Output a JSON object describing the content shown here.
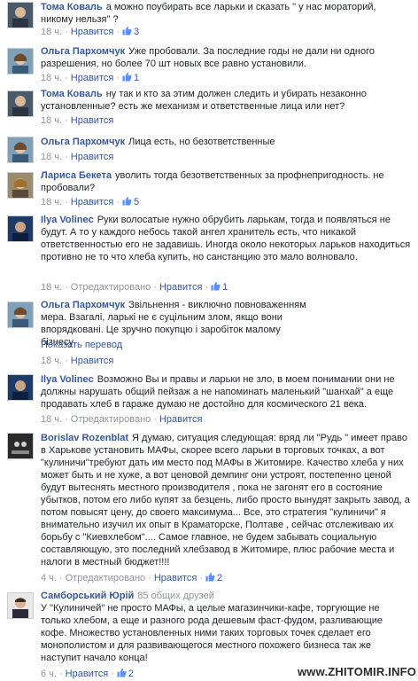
{
  "comments": [
    {
      "author": "Тома Коваль",
      "text": "а можно поубирать все ларьки и сказать \" у нас мораторий, никому нельзя\" ?",
      "time": "18 ч.",
      "like_label": "Нравится",
      "likes": "3"
    },
    {
      "author": "Ольга Пархомчук",
      "text": "Уже пробовали. За последние годы не дали ни одного разрешения, но более 70 шт новых все равно установили.",
      "time": "18 ч.",
      "like_label": "Нравится",
      "likes": "1"
    },
    {
      "author": "Тома Коваль",
      "text": "ну так и кто за этим должен следить и убирать незаконно установленные? есть же механизм и ответственные лица или нет?",
      "time": "18 ч.",
      "like_label": "Нравится"
    },
    {
      "author": "Ольга Пархомчук",
      "text": "Лица есть, но безответственные",
      "time": "18 ч.",
      "like_label": "Нравится"
    },
    {
      "author": "Лариса Бекета",
      "text": "уволить тогда безответственных за профнепригодность. не пробовали?",
      "time": "18 ч.",
      "like_label": "Нравится",
      "likes": "5"
    },
    {
      "author": "Ilya Volinec",
      "text": "Руки волосатые нужно обрубить ларькам, тогда и появляться не будут. А то у каждого небось такой ангел хранитель есть, что никакой ответственностью его не задавишь. Иногда около некоторых ларьков находиться противно не то что хлеба купить, но санстанцию это мало волновало.",
      "time": "18 ч.",
      "edited": "Отредактировано",
      "like_label": "Нравится",
      "likes": "1"
    },
    {
      "author": "Ольга Пархомчук",
      "text": "Звільнення - виключно повноваженням мера. Взагалі, ларькі не є суцільним злом, якщо вони впорядковані. Це зручно покупцю і заробіток малому бізнесу",
      "translate": "Показать перевод",
      "time": "18 ч.",
      "like_label": "Нравится"
    },
    {
      "author": "Ilya Volinec",
      "text": "Возможно Вы и правы и ларьки не зло, в моем понимании они не должны нарушать общий пейзаж а не напоминать маленький \"шанхай\" а еще продавать хлеб в гараже думаю не достойно для космического 21 века.",
      "time": "18 ч.",
      "edited": "Отредактировано",
      "like_label": "Нравится"
    },
    {
      "author": "Borislav Rozenblat",
      "text": "Я думаю, ситуация следующая: вряд ли \"Рудь \" имеет право в Харькове установить МАФы, скорее всего ларьки в торговых точках, а вот \"кулиничи\"требуют дать им место под МАФы в Житомире. Качество хлеба у них может быть и не хуже, а вот ценовой демпинг они устроят, постепенно ценой будут вытеснять местного производителя , пока не загонят его в состояние убытков, потом его либо купят за безцень, либо просто вынудят закрыть завод, а потом повысят цену, до своего максимума... Все, это стратегия \"кулиничи\" я внимательно изучил их опыт в Краматорске, Полтаве , сейчас отслеживаю их борьбу с \"Киевхлебом\".... Самое главное, не будем забывать социальную составляющую, это последний хлебзавод в Житомире, плюс рабочие места и налоги в местный бюджет!!!!",
      "time": "4 ч.",
      "edited": "Отредактировано",
      "like_label": "Нравится",
      "likes": "2"
    },
    {
      "author": "Самборський Юрій",
      "friends": "85 общих друзей",
      "text": "У \"Кулиничей\" не просто МАФы, а целые магазинчики-кафе, торгующие не только хлебом, а еще и разного рода дешевым фаст-фудом, разливающие кофе. Множество установленных ними таких торговых точек сделает его монополистом и для развивающегося местного похожего бизнеса так же наступит начало конца!",
      "time": "6 ч.",
      "like_label": "Нравится",
      "likes": "2"
    }
  ],
  "watermark": "www.ZHITOMIR.INFO",
  "colors": {
    "link": "#365899",
    "meta": "#90949c",
    "text": "#1d2129"
  }
}
